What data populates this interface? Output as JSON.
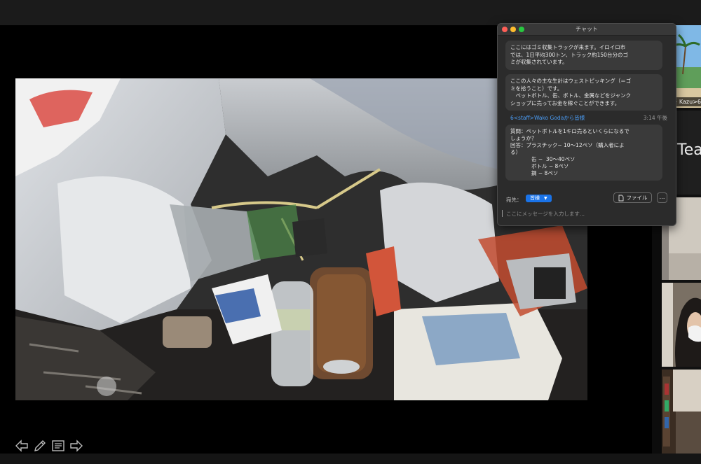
{
  "chat": {
    "title": "チャット",
    "messages": [
      {
        "text": "ここにはゴミ収集トラックが来ます。イロイロ市\nでは、1日平均300トン、トラック約150台分のゴ\nミが収集されています。"
      },
      {
        "text": "ここの人々の主な生計はウェストピッキング（＝ゴ\nミを拾うこと）です。\n　ペットボトル、缶、ボトル、金属などをジャンク\nショップに売ってお金を稼ぐことができます。"
      },
      {
        "text": "質問：ペットボトルを1キロ売るといくらになるで\nしょうか？\n回答：プラスチック− 10〜12ペソ（購入者によ\nる）\n　　　　缶 −  30〜40ペソ\n　　　　ボトル − 8ペソ\n　　　　鋼 − 8ペソ"
      }
    ],
    "sender": "6<staff>Wako Godaから皆様",
    "time": "3:14 午後",
    "to_label": "宛先：",
    "to_value": "皆様",
    "file_label": "ファイル",
    "more_label": "…",
    "input_placeholder": "ここにメッセージを入力します..."
  },
  "participants": {
    "tile1_name": "6<staff> Kazu",
    "tile2_text": "Tea"
  },
  "icons": {
    "tools": [
      "arrow-left-icon",
      "pen-icon",
      "text-note-icon",
      "arrow-right-icon"
    ]
  },
  "colors": {
    "accent": "#1a73e8",
    "sender": "#4a9cf5"
  }
}
